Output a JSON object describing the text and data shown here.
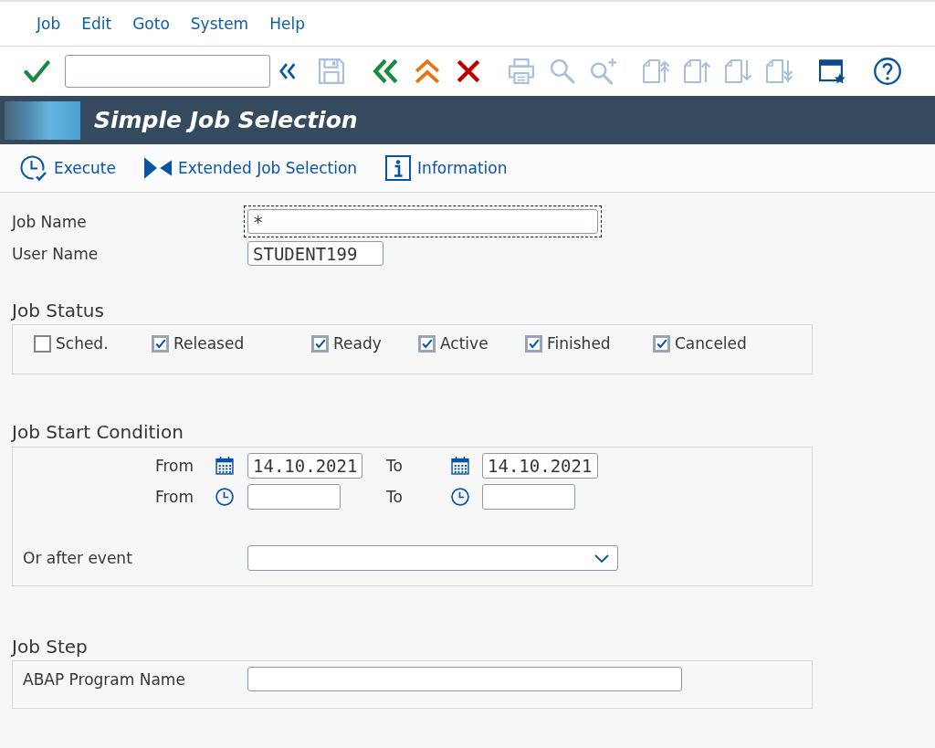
{
  "menu_bar": {
    "items": [
      "Job",
      "Edit",
      "Goto",
      "System",
      "Help"
    ]
  },
  "toolbar": {
    "items": [
      {
        "kind": "enter",
        "disabled": false
      },
      {
        "kind": "command_field",
        "disabled": false
      },
      {
        "kind": "expand",
        "disabled": false
      },
      {
        "kind": "save",
        "disabled": true
      },
      {
        "kind": "back",
        "disabled": false
      },
      {
        "kind": "exit",
        "disabled": false
      },
      {
        "kind": "cancel",
        "disabled": false
      },
      {
        "kind": "print",
        "disabled": true
      },
      {
        "kind": "find",
        "disabled": true
      },
      {
        "kind": "find_next",
        "disabled": true
      },
      {
        "kind": "first_page",
        "disabled": true
      },
      {
        "kind": "previous_page",
        "disabled": true
      },
      {
        "kind": "next_page",
        "disabled": true
      },
      {
        "kind": "last_page",
        "disabled": true
      },
      {
        "kind": "layout",
        "disabled": false
      },
      {
        "kind": "help",
        "disabled": false
      }
    ]
  },
  "title_bar": {
    "title": "Simple Job Selection"
  },
  "app_toolbar": {
    "buttons": [
      {
        "kind": "execute",
        "label": "Execute"
      },
      {
        "kind": "extended_selection",
        "label": "Extended Job Selection"
      },
      {
        "kind": "information",
        "label": "Information"
      }
    ]
  },
  "selection_fields": [
    {
      "label": "Job Name",
      "value": "*",
      "focused": true
    },
    {
      "label": "User Name",
      "value": "STUDENT199",
      "focused": false
    }
  ],
  "job_status": {
    "title": "Job Status",
    "options": [
      {
        "label": "Sched.",
        "checked": false
      },
      {
        "label": "Released",
        "checked": true
      },
      {
        "label": "Ready",
        "checked": true
      },
      {
        "label": "Active",
        "checked": true
      },
      {
        "label": "Finished",
        "checked": true
      },
      {
        "label": "Canceled",
        "checked": true
      }
    ]
  },
  "job_start_condition": {
    "title": "Job Start Condition",
    "rows": [
      {
        "kind": "date",
        "from_label": "From",
        "from_value": "14.10.2021",
        "to_label": "To",
        "to_value": "14.10.2021"
      },
      {
        "kind": "time",
        "from_label": "From",
        "to_label": "To"
      }
    ],
    "event": {
      "label": "Or after event"
    }
  },
  "job_step": {
    "title": "Job Step",
    "fields": [
      {
        "label": "ABAP Program Name"
      }
    ]
  }
}
